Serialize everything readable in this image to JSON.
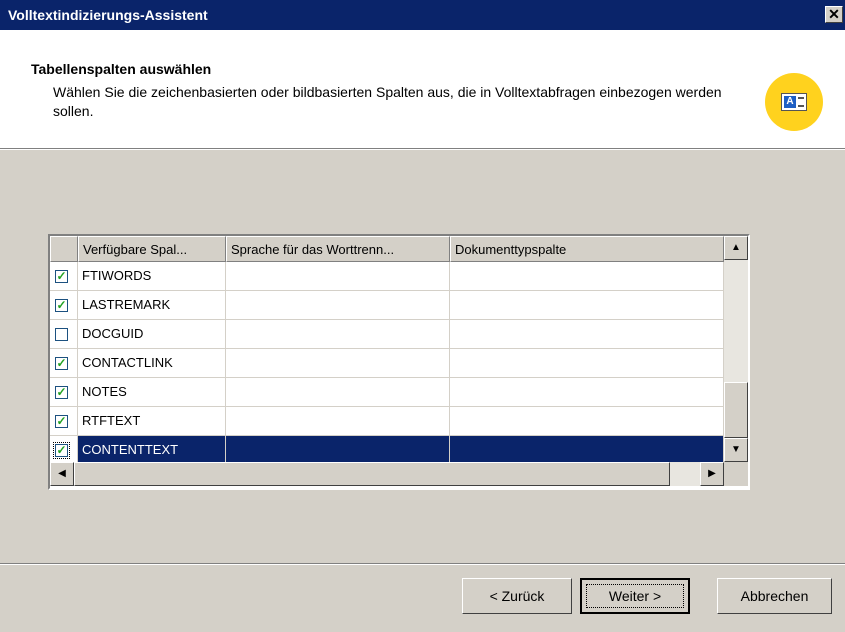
{
  "window": {
    "title": "Volltextindizierungs-Assistent",
    "close_glyph": "✕"
  },
  "header": {
    "title": "Tabellenspalten auswählen",
    "description": "Wählen Sie die zeichenbasierten oder bildbasierten Spalten aus, die in Volltextabfragen einbezogen werden sollen.",
    "icon": "wizard-icon",
    "icon_letter": "A",
    "icon_color": "#ffd21e"
  },
  "grid": {
    "columns": [
      "Verfügbare Spal...",
      "Sprache für das Worttrenn...",
      "Dokumenttypspalte"
    ],
    "rows": [
      {
        "checked": true,
        "name": "FTIWORDS",
        "language": "",
        "doctype": ""
      },
      {
        "checked": true,
        "name": "LASTREMARK",
        "language": "",
        "doctype": ""
      },
      {
        "checked": false,
        "name": "DOCGUID",
        "language": "",
        "doctype": ""
      },
      {
        "checked": true,
        "name": "CONTACTLINK",
        "language": "",
        "doctype": ""
      },
      {
        "checked": true,
        "name": "NOTES",
        "language": "",
        "doctype": ""
      },
      {
        "checked": true,
        "name": "RTFTEXT",
        "language": "",
        "doctype": ""
      },
      {
        "checked": true,
        "name": "CONTENTTEXT",
        "language": "",
        "doctype": "",
        "selected": true
      }
    ],
    "selection_color": "#0a246a"
  },
  "buttons": {
    "back": "< Zurück",
    "next": "Weiter >",
    "cancel": "Abbrechen"
  },
  "colors": {
    "titlebar": "#0a246a",
    "dialog": "#d4d0c8"
  }
}
